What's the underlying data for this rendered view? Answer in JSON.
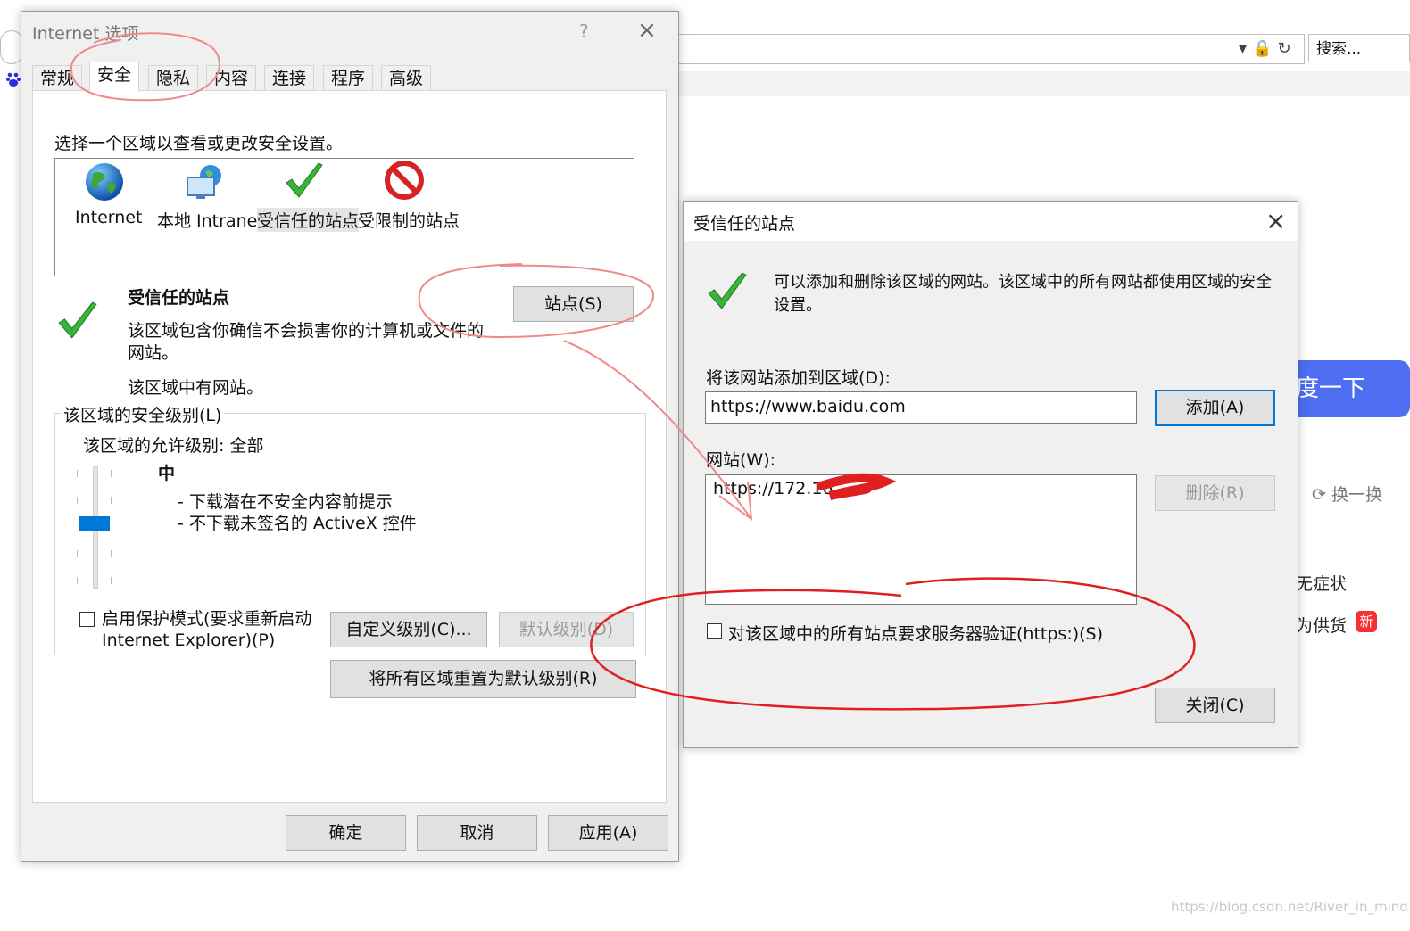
{
  "browser": {
    "search_placeholder": "搜索...",
    "icons": [
      "dropdown-arrow-icon",
      "lock-icon",
      "refresh-icon"
    ],
    "search_button": "度一下",
    "refresh_link": "换一换",
    "hot_items": [
      "无症状",
      "为供货"
    ],
    "new_badge": "新",
    "watermark": "https://blog.csdn.net/River_in_mind"
  },
  "options_dialog": {
    "title": "Internet 选项",
    "help": "?",
    "close": "×",
    "tabs": [
      "常规",
      "安全",
      "隐私",
      "内容",
      "连接",
      "程序",
      "高级"
    ],
    "active_tab": "安全",
    "instruction": "选择一个区域以查看或更改安全设置。",
    "zones": [
      {
        "label": "Internet",
        "icon": "globe-icon"
      },
      {
        "label": "本地 Intranet",
        "icon": "intranet-icon"
      },
      {
        "label": "受信任的站点",
        "icon": "checkmark-icon",
        "selected": true
      },
      {
        "label": "受限制的站点",
        "icon": "restricted-icon"
      }
    ],
    "zone_title": "受信任的站点",
    "zone_desc": "该区域包含你确信不会损害你的计算机或文件的网站。",
    "zone_has_sites": "该区域中有网站。",
    "sites_button": "站点(S)",
    "security_level_legend": "该区域的安全级别(L)",
    "allowed_levels": "该区域的允许级别: 全部",
    "level_name": "中",
    "level_desc_1": "- 下载潜在不安全内容前提示",
    "level_desc_2": "- 不下载未签名的 ActiveX 控件",
    "protected_mode_line1": "启用保护模式(要求重新启动",
    "protected_mode_line2": "Internet Explorer)(P)",
    "protected_mode_checked": false,
    "custom_level_button": "自定义级别(C)...",
    "default_level_button": "默认级别(D)",
    "reset_all_button": "将所有区域重置为默认级别(R)",
    "ok_button": "确定",
    "cancel_button": "取消",
    "apply_button": "应用(A)"
  },
  "trusted_dialog": {
    "title": "受信任的站点",
    "close": "×",
    "desc_line1": "可以添加和删除该区域的网站。该区域中的所有网站都使用区域的安全",
    "desc_line2": "设置。",
    "add_label": "将该网站添加到区域(D):",
    "add_value": "https://www.baidu.com",
    "add_button": "添加(A)",
    "sites_label": "网站(W):",
    "sites": [
      "https://172.16."
    ],
    "remove_button": "删除(R)",
    "require_https_label": "对该区域中的所有站点要求服务器验证(https:)(S)",
    "require_https_checked": false,
    "close_button": "关闭(C)"
  },
  "colors": {
    "annotation_red": "#e02020",
    "annotation_pink": "#f08a8a",
    "accent_blue": "#0078d7",
    "baidu_blue": "#4e6ef2"
  }
}
